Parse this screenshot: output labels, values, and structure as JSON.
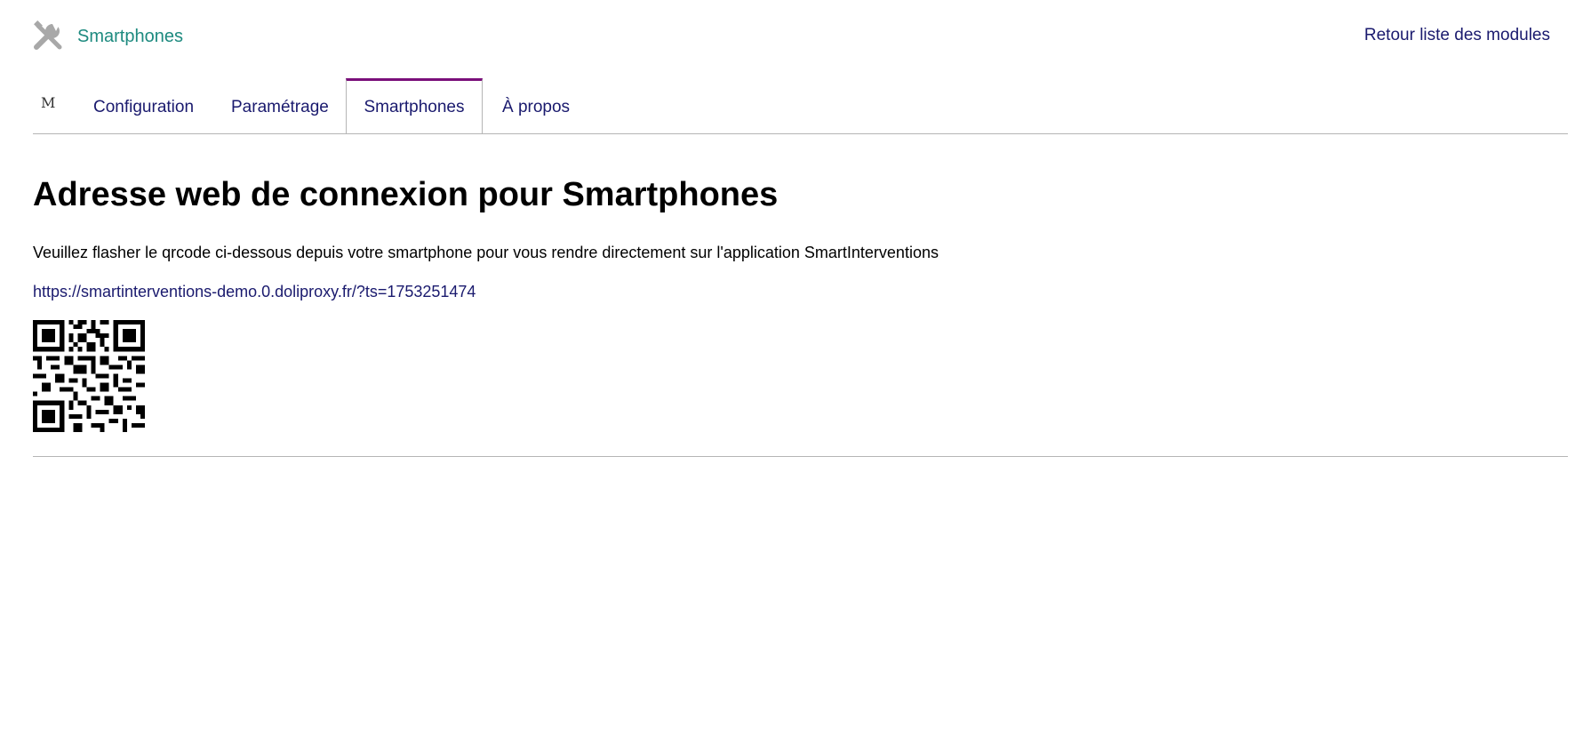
{
  "header": {
    "module_title": "Smartphones",
    "back_link": "Retour liste des modules",
    "icon": "tools-icon"
  },
  "tabs": [
    {
      "label": "M"
    },
    {
      "label": "Configuration"
    },
    {
      "label": "Paramétrage"
    },
    {
      "label": "Smartphones",
      "active": true
    },
    {
      "label": "À propos"
    }
  ],
  "main": {
    "title": "Adresse web de connexion pour Smartphones",
    "description": "Veuillez flasher le qrcode ci-dessous depuis votre smartphone pour vous rendre directement sur l'application SmartInterventions",
    "url": "https://smartinterventions-demo.0.doliproxy.fr/?ts=1753251474",
    "qr_icon": "qr-code-icon"
  },
  "colors": {
    "module_title": "#1d8a7f",
    "link": "#1a1a6e",
    "active_tab_accent": "#7a0f7a"
  }
}
